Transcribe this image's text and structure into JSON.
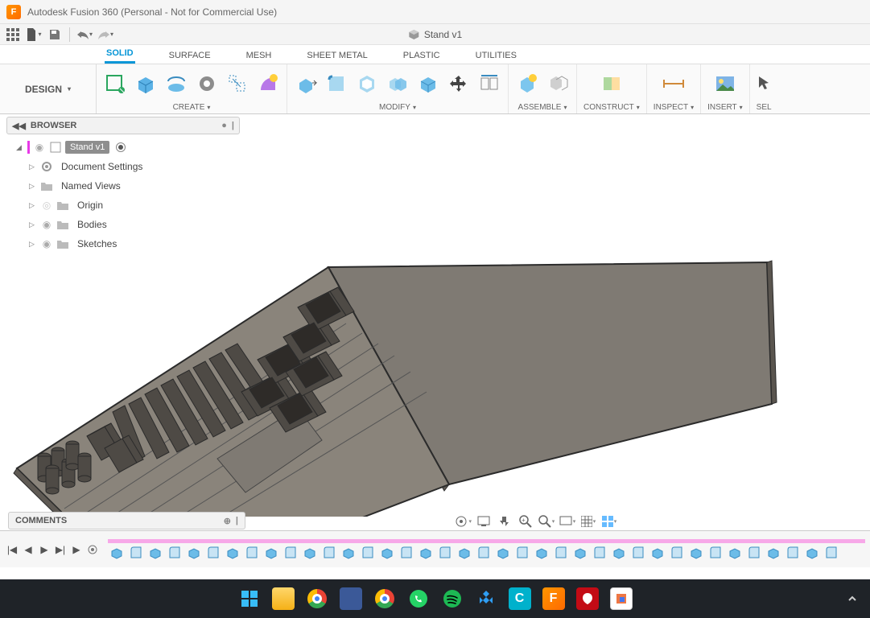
{
  "titlebar": {
    "title": "Autodesk Fusion 360 (Personal - Not for Commercial Use)"
  },
  "document_tab": {
    "name": "Stand v1"
  },
  "workspace_button": "DESIGN",
  "ws_tabs": [
    "SOLID",
    "SURFACE",
    "MESH",
    "SHEET METAL",
    "PLASTIC",
    "UTILITIES"
  ],
  "ribbon_groups": {
    "create": "CREATE",
    "modify": "MODIFY",
    "assemble": "ASSEMBLE",
    "construct": "CONSTRUCT",
    "inspect": "INSPECT",
    "insert": "INSERT",
    "select": "SEL"
  },
  "browser": {
    "title": "BROWSER",
    "root": "Stand v1",
    "items": [
      {
        "label": "Document Settings",
        "icon": "gear"
      },
      {
        "label": "Named Views",
        "icon": "folder"
      },
      {
        "label": "Origin",
        "icon": "folder"
      },
      {
        "label": "Bodies",
        "icon": "folder"
      },
      {
        "label": "Sketches",
        "icon": "folder"
      }
    ]
  },
  "comments": {
    "title": "COMMENTS"
  },
  "nav_tools": [
    "orbit",
    "fit",
    "pan",
    "zoom",
    "zoom-window",
    "display",
    "grid",
    "viewports"
  ]
}
